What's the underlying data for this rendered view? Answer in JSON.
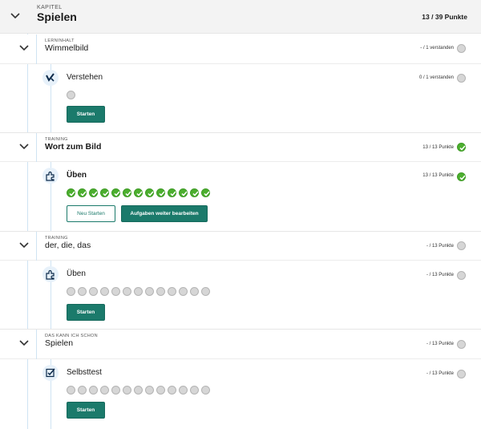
{
  "chapter": {
    "overline": "KAPITEL",
    "title": "Spielen",
    "points": "13 / 39 Punkte"
  },
  "sections": [
    {
      "overline": "LERNINHALT",
      "title": "Wimmelbild",
      "points": "- / 1 verstanden",
      "status": "empty",
      "activity": {
        "icon": "verstehen-icon",
        "title": "Verstehen",
        "points": "0 / 1 verstanden",
        "status": "empty",
        "dots": [
          "empty"
        ],
        "buttons": [
          {
            "label": "Starten",
            "style": "primary"
          }
        ]
      }
    },
    {
      "overline": "TRAINING",
      "title": "Wort zum Bild",
      "points": "13 / 13 Punkte",
      "status": "done",
      "activity": {
        "icon": "puzzle-icon",
        "title": "Üben",
        "points": "13 / 13 Punkte",
        "status": "done",
        "dots": [
          "done",
          "done",
          "done",
          "done",
          "done",
          "done",
          "done",
          "done",
          "done",
          "done",
          "done",
          "done",
          "done"
        ],
        "buttons": [
          {
            "label": "Neu Starten",
            "style": "secondary"
          },
          {
            "label": "Aufgaben weiter bearbeiten",
            "style": "primary"
          }
        ]
      }
    },
    {
      "overline": "TRAINING",
      "title": "der, die, das",
      "points": "- / 13 Punkte",
      "status": "empty",
      "activity": {
        "icon": "puzzle-icon",
        "title": "Üben",
        "points": "- / 13 Punkte",
        "status": "empty",
        "dots": [
          "empty",
          "empty",
          "empty",
          "empty",
          "empty",
          "empty",
          "empty",
          "empty",
          "empty",
          "empty",
          "empty",
          "empty",
          "empty"
        ],
        "buttons": [
          {
            "label": "Starten",
            "style": "primary"
          }
        ]
      }
    },
    {
      "overline": "DAS KANN ICH SCHON",
      "title": "Spielen",
      "points": "- / 13 Punkte",
      "status": "empty",
      "activity": {
        "icon": "checkbox-icon",
        "title": "Selbsttest",
        "points": "- / 13 Punkte",
        "status": "empty",
        "dots": [
          "empty",
          "empty",
          "empty",
          "empty",
          "empty",
          "empty",
          "empty",
          "empty",
          "empty",
          "empty",
          "empty",
          "empty",
          "empty"
        ],
        "buttons": [
          {
            "label": "Starten",
            "style": "primary"
          }
        ]
      }
    }
  ],
  "colors": {
    "accent": "#1b7a6b",
    "success": "#4caf2f",
    "timeline": "#cfe3f3",
    "header_bg": "#f3f3f3"
  }
}
